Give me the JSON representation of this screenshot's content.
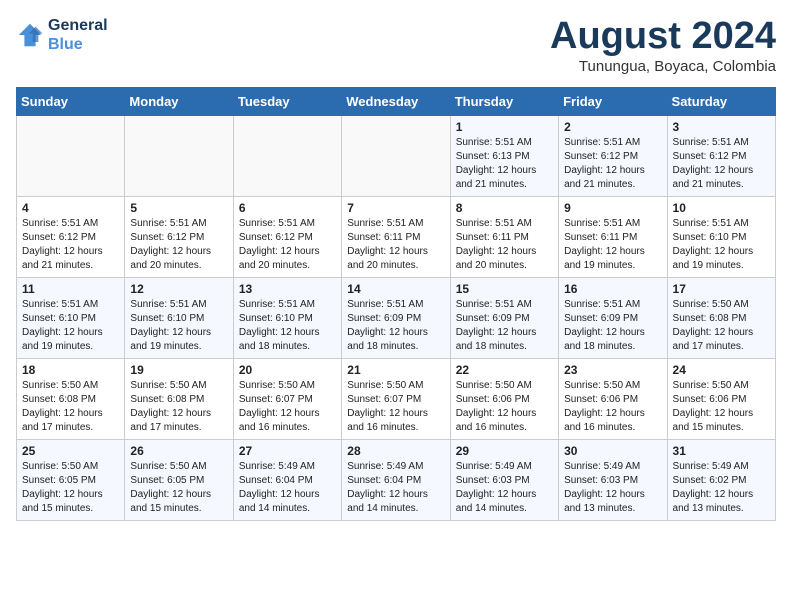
{
  "header": {
    "logo_line1": "General",
    "logo_line2": "Blue",
    "main_title": "August 2024",
    "subtitle": "Tunungua, Boyaca, Colombia"
  },
  "calendar": {
    "days_of_week": [
      "Sunday",
      "Monday",
      "Tuesday",
      "Wednesday",
      "Thursday",
      "Friday",
      "Saturday"
    ],
    "weeks": [
      [
        {
          "day": "",
          "info": ""
        },
        {
          "day": "",
          "info": ""
        },
        {
          "day": "",
          "info": ""
        },
        {
          "day": "",
          "info": ""
        },
        {
          "day": "1",
          "info": "Sunrise: 5:51 AM\nSunset: 6:13 PM\nDaylight: 12 hours\nand 21 minutes."
        },
        {
          "day": "2",
          "info": "Sunrise: 5:51 AM\nSunset: 6:12 PM\nDaylight: 12 hours\nand 21 minutes."
        },
        {
          "day": "3",
          "info": "Sunrise: 5:51 AM\nSunset: 6:12 PM\nDaylight: 12 hours\nand 21 minutes."
        }
      ],
      [
        {
          "day": "4",
          "info": "Sunrise: 5:51 AM\nSunset: 6:12 PM\nDaylight: 12 hours\nand 21 minutes."
        },
        {
          "day": "5",
          "info": "Sunrise: 5:51 AM\nSunset: 6:12 PM\nDaylight: 12 hours\nand 20 minutes."
        },
        {
          "day": "6",
          "info": "Sunrise: 5:51 AM\nSunset: 6:12 PM\nDaylight: 12 hours\nand 20 minutes."
        },
        {
          "day": "7",
          "info": "Sunrise: 5:51 AM\nSunset: 6:11 PM\nDaylight: 12 hours\nand 20 minutes."
        },
        {
          "day": "8",
          "info": "Sunrise: 5:51 AM\nSunset: 6:11 PM\nDaylight: 12 hours\nand 20 minutes."
        },
        {
          "day": "9",
          "info": "Sunrise: 5:51 AM\nSunset: 6:11 PM\nDaylight: 12 hours\nand 19 minutes."
        },
        {
          "day": "10",
          "info": "Sunrise: 5:51 AM\nSunset: 6:10 PM\nDaylight: 12 hours\nand 19 minutes."
        }
      ],
      [
        {
          "day": "11",
          "info": "Sunrise: 5:51 AM\nSunset: 6:10 PM\nDaylight: 12 hours\nand 19 minutes."
        },
        {
          "day": "12",
          "info": "Sunrise: 5:51 AM\nSunset: 6:10 PM\nDaylight: 12 hours\nand 19 minutes."
        },
        {
          "day": "13",
          "info": "Sunrise: 5:51 AM\nSunset: 6:10 PM\nDaylight: 12 hours\nand 18 minutes."
        },
        {
          "day": "14",
          "info": "Sunrise: 5:51 AM\nSunset: 6:09 PM\nDaylight: 12 hours\nand 18 minutes."
        },
        {
          "day": "15",
          "info": "Sunrise: 5:51 AM\nSunset: 6:09 PM\nDaylight: 12 hours\nand 18 minutes."
        },
        {
          "day": "16",
          "info": "Sunrise: 5:51 AM\nSunset: 6:09 PM\nDaylight: 12 hours\nand 18 minutes."
        },
        {
          "day": "17",
          "info": "Sunrise: 5:50 AM\nSunset: 6:08 PM\nDaylight: 12 hours\nand 17 minutes."
        }
      ],
      [
        {
          "day": "18",
          "info": "Sunrise: 5:50 AM\nSunset: 6:08 PM\nDaylight: 12 hours\nand 17 minutes."
        },
        {
          "day": "19",
          "info": "Sunrise: 5:50 AM\nSunset: 6:08 PM\nDaylight: 12 hours\nand 17 minutes."
        },
        {
          "day": "20",
          "info": "Sunrise: 5:50 AM\nSunset: 6:07 PM\nDaylight: 12 hours\nand 16 minutes."
        },
        {
          "day": "21",
          "info": "Sunrise: 5:50 AM\nSunset: 6:07 PM\nDaylight: 12 hours\nand 16 minutes."
        },
        {
          "day": "22",
          "info": "Sunrise: 5:50 AM\nSunset: 6:06 PM\nDaylight: 12 hours\nand 16 minutes."
        },
        {
          "day": "23",
          "info": "Sunrise: 5:50 AM\nSunset: 6:06 PM\nDaylight: 12 hours\nand 16 minutes."
        },
        {
          "day": "24",
          "info": "Sunrise: 5:50 AM\nSunset: 6:06 PM\nDaylight: 12 hours\nand 15 minutes."
        }
      ],
      [
        {
          "day": "25",
          "info": "Sunrise: 5:50 AM\nSunset: 6:05 PM\nDaylight: 12 hours\nand 15 minutes."
        },
        {
          "day": "26",
          "info": "Sunrise: 5:50 AM\nSunset: 6:05 PM\nDaylight: 12 hours\nand 15 minutes."
        },
        {
          "day": "27",
          "info": "Sunrise: 5:49 AM\nSunset: 6:04 PM\nDaylight: 12 hours\nand 14 minutes."
        },
        {
          "day": "28",
          "info": "Sunrise: 5:49 AM\nSunset: 6:04 PM\nDaylight: 12 hours\nand 14 minutes."
        },
        {
          "day": "29",
          "info": "Sunrise: 5:49 AM\nSunset: 6:03 PM\nDaylight: 12 hours\nand 14 minutes."
        },
        {
          "day": "30",
          "info": "Sunrise: 5:49 AM\nSunset: 6:03 PM\nDaylight: 12 hours\nand 13 minutes."
        },
        {
          "day": "31",
          "info": "Sunrise: 5:49 AM\nSunset: 6:02 PM\nDaylight: 12 hours\nand 13 minutes."
        }
      ]
    ]
  }
}
